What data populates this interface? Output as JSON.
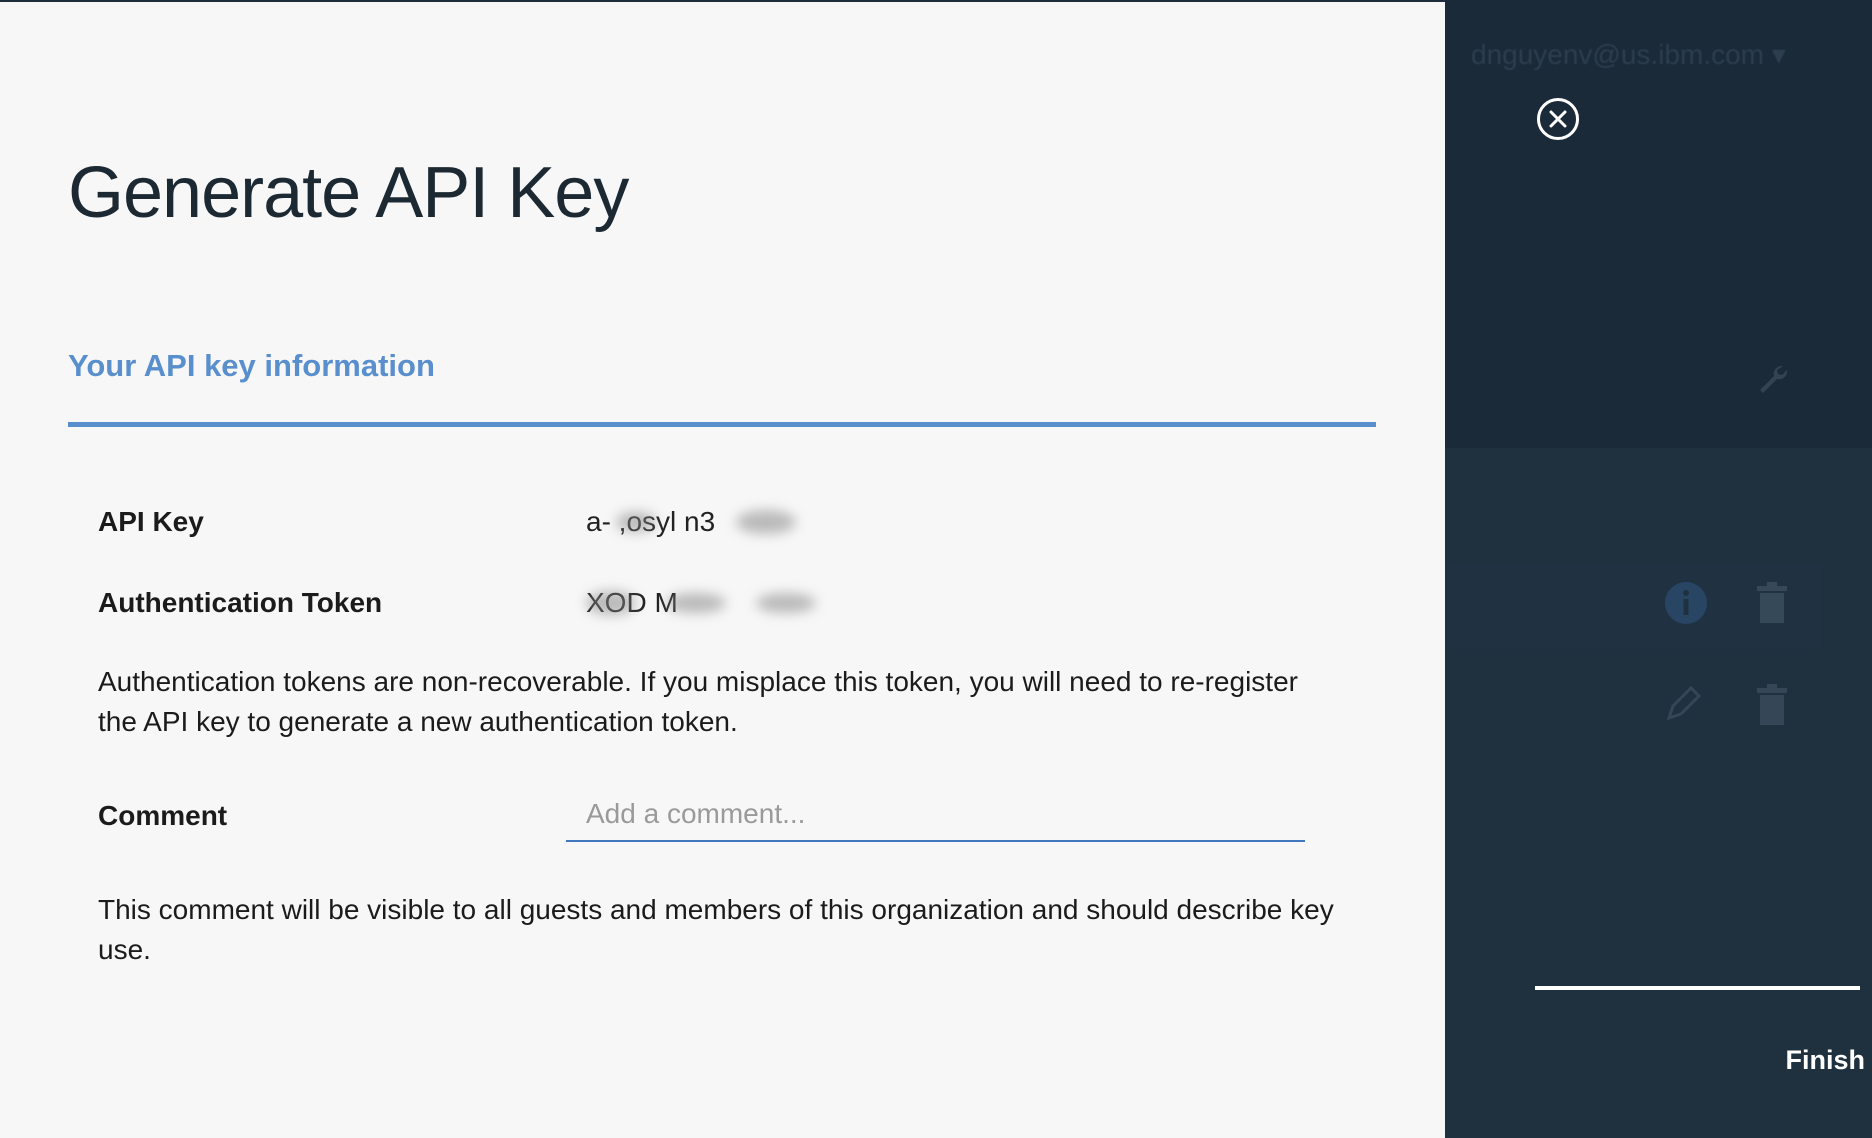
{
  "modal": {
    "title": "Generate API Key",
    "section_title": "Your API key information",
    "fields": {
      "api_key_label": "API Key",
      "api_key_value": "a-  ,osyl  n3",
      "auth_token_label": "Authentication Token",
      "auth_token_value": "  XOD M"
    },
    "token_note": "Authentication tokens are non-recoverable. If you misplace this token, you will need to re-register the API key to generate a new authentication token.",
    "comment_label": "Comment",
    "comment_placeholder": "Add a comment...",
    "comment_note": "This comment will be visible to all guests and members of this organization and should describe key use."
  },
  "side_panel": {
    "user_email": "dnguyenv@us.ibm.com ▾",
    "finish_label": "Finish",
    "icons": [
      "close-icon",
      "wrench-icon",
      "info-icon",
      "trash-icon",
      "pencil-icon"
    ]
  },
  "colors": {
    "accent": "#5a8fce",
    "input_underline": "#4178be",
    "dark_panel": "#1d2d3b",
    "modal_bg": "#f7f7f7"
  }
}
